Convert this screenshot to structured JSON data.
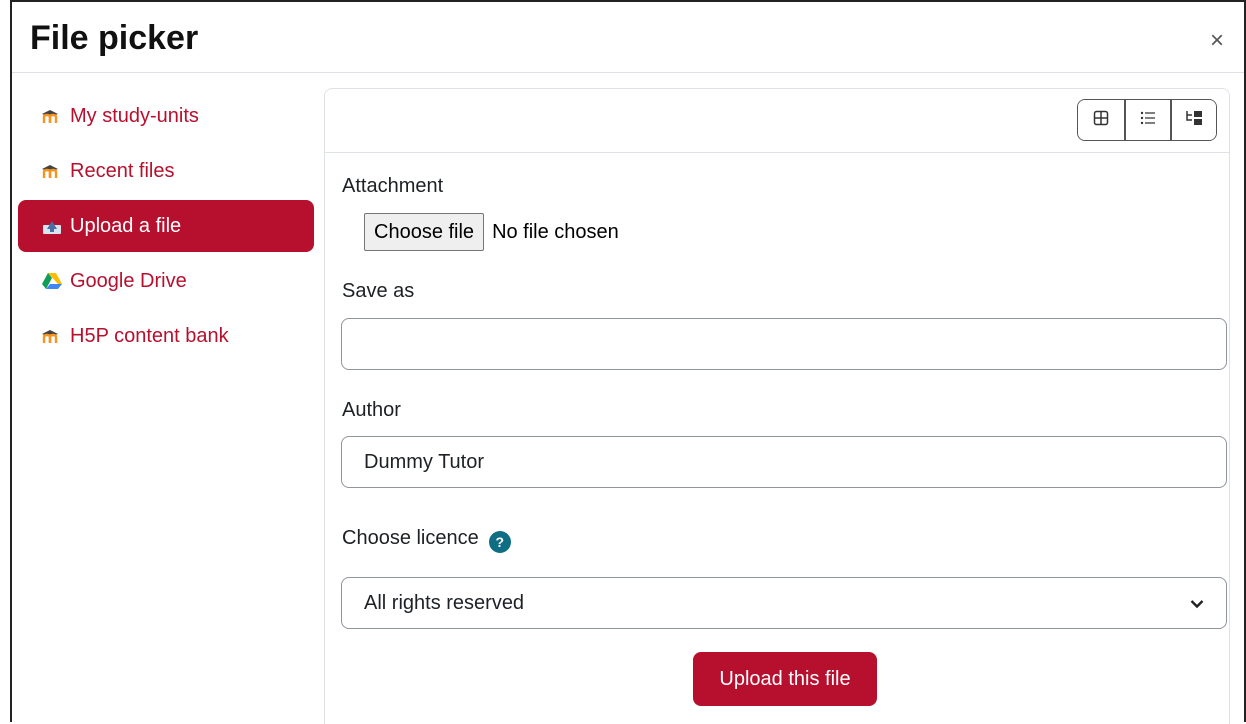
{
  "dialog": {
    "title": "File picker",
    "close_label": "×"
  },
  "sidebar": {
    "items": [
      {
        "label": "My study-units",
        "icon": "moodle-icon",
        "active": false
      },
      {
        "label": "Recent files",
        "icon": "moodle-icon",
        "active": false
      },
      {
        "label": "Upload a file",
        "icon": "upload-icon",
        "active": true
      },
      {
        "label": "Google Drive",
        "icon": "google-drive-icon",
        "active": false
      },
      {
        "label": "H5P content bank",
        "icon": "moodle-icon",
        "active": false
      }
    ]
  },
  "toolbar": {
    "views": [
      "icons-view-icon",
      "list-view-icon",
      "tree-view-icon"
    ]
  },
  "form": {
    "attachment_label": "Attachment",
    "choose_file_label": "Choose file",
    "file_status": "No file chosen",
    "save_as_label": "Save as",
    "save_as_value": "",
    "author_label": "Author",
    "author_value": "Dummy Tutor",
    "licence_label": "Choose licence",
    "help_glyph": "?",
    "licence_value": "All rights reserved",
    "upload_label": "Upload this file"
  },
  "colors": {
    "accent": "#b7102f",
    "help": "#0f6e84"
  }
}
